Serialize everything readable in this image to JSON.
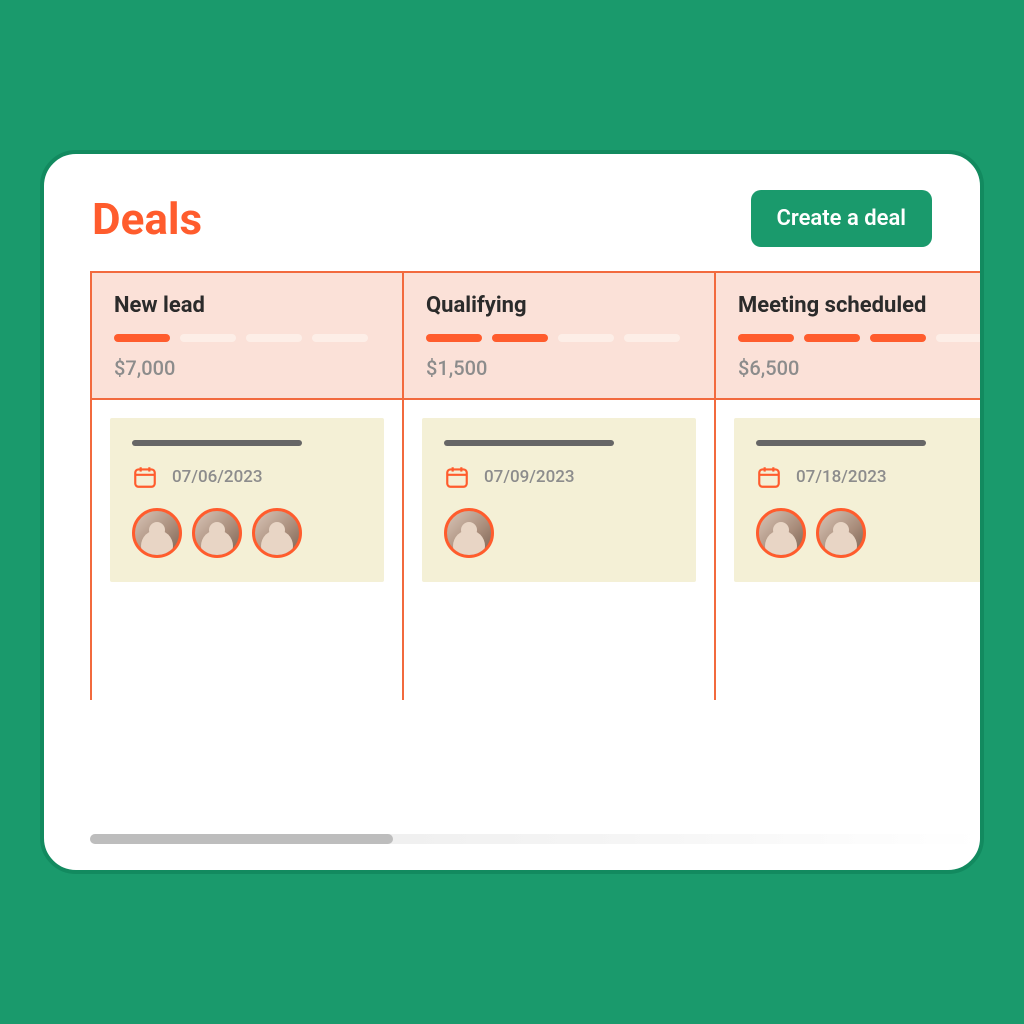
{
  "header": {
    "title": "Deals",
    "create_label": "Create a deal"
  },
  "columns": [
    {
      "title": "New lead",
      "progress_total": 4,
      "progress_filled": 1,
      "amount": "$7,000",
      "card": {
        "date": "07/06/2023",
        "avatar_count": 3
      }
    },
    {
      "title": "Qualifying",
      "progress_total": 4,
      "progress_filled": 2,
      "amount": "$1,500",
      "card": {
        "date": "07/09/2023",
        "avatar_count": 1
      }
    },
    {
      "title": "Meeting scheduled",
      "progress_total": 4,
      "progress_filled": 3,
      "amount": "$6,500",
      "card": {
        "date": "07/18/2023",
        "avatar_count": 2
      }
    }
  ],
  "icons": {
    "calendar": "calendar-icon"
  }
}
